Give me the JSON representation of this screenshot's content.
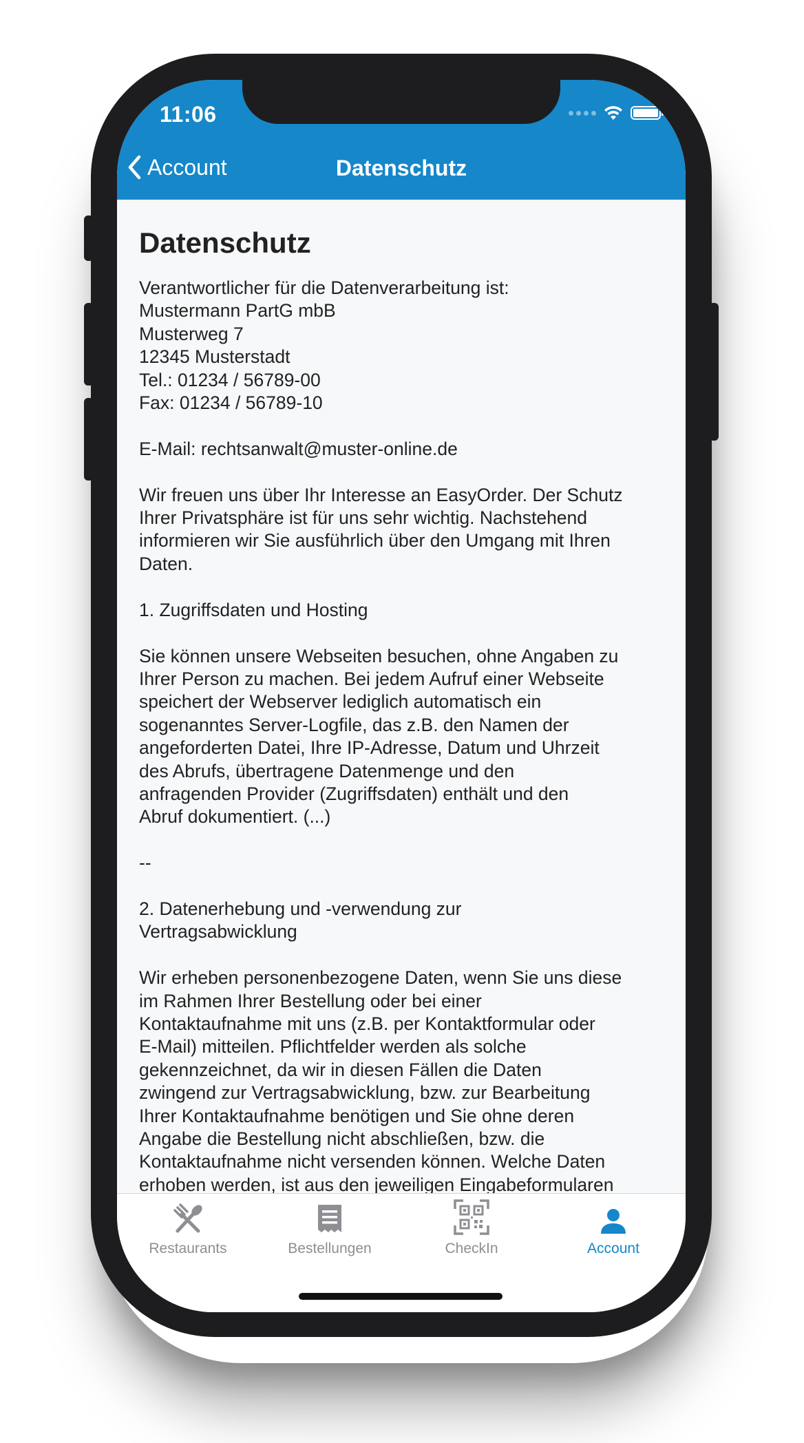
{
  "status_bar": {
    "time": "11:06"
  },
  "nav": {
    "back_label": "Account",
    "title": "Datenschutz"
  },
  "content": {
    "heading": "Datenschutz",
    "body": "Verantwortlicher für die Datenverarbeitung ist:\nMustermann PartG mbB\nMusterweg 7\n12345 Musterstadt\nTel.: 01234 / 56789-00\nFax: 01234 / 56789-10\n\nE-Mail: rechtsanwalt@muster-online.de\n\nWir freuen uns über Ihr Interesse an EasyOrder. Der Schutz\nIhrer Privatsphäre ist für uns sehr wichtig. Nachstehend\ninformieren wir Sie ausführlich über den Umgang mit Ihren\nDaten.\n\n1. Zugriffsdaten und Hosting\n\nSie können unsere Webseiten besuchen, ohne Angaben zu\nIhrer Person zu machen. Bei jedem Aufruf einer Webseite\nspeichert der Webserver lediglich automatisch ein\nsogenanntes Server-Logfile, das z.B. den Namen der\nangeforderten Datei, Ihre IP-Adresse, Datum und Uhrzeit\ndes Abrufs, übertragene Datenmenge und den\nanfragenden Provider (Zugriffsdaten) enthält und den\nAbruf dokumentiert. (...)\n\n--\n\n2. Datenerhebung und -verwendung zur\nVertragsabwicklung\n\nWir erheben personenbezogene Daten, wenn Sie uns diese\nim Rahmen Ihrer Bestellung oder bei einer\nKontaktaufnahme mit uns (z.B. per Kontaktformular oder\nE-Mail) mitteilen. Pflichtfelder werden als solche\ngekennzeichnet, da wir in diesen Fällen die Daten\nzwingend zur Vertragsabwicklung, bzw. zur Bearbeitung\nIhrer Kontaktaufnahme benötigen und Sie ohne deren\nAngabe die Bestellung nicht abschließen, bzw. die\nKontaktaufnahme nicht versenden können. Welche Daten\nerhoben werden, ist aus den jeweiligen Eingabeformularen"
  },
  "tabs": [
    {
      "label": "Restaurants",
      "icon": "cutlery-icon"
    },
    {
      "label": "Bestellungen",
      "icon": "receipt-icon"
    },
    {
      "label": "CheckIn",
      "icon": "qr-code-icon"
    },
    {
      "label": "Account",
      "icon": "person-icon",
      "active": true
    }
  ],
  "colors": {
    "accent": "#1687c9",
    "inactive": "#8e8e93",
    "background": "#f7f8fa"
  }
}
